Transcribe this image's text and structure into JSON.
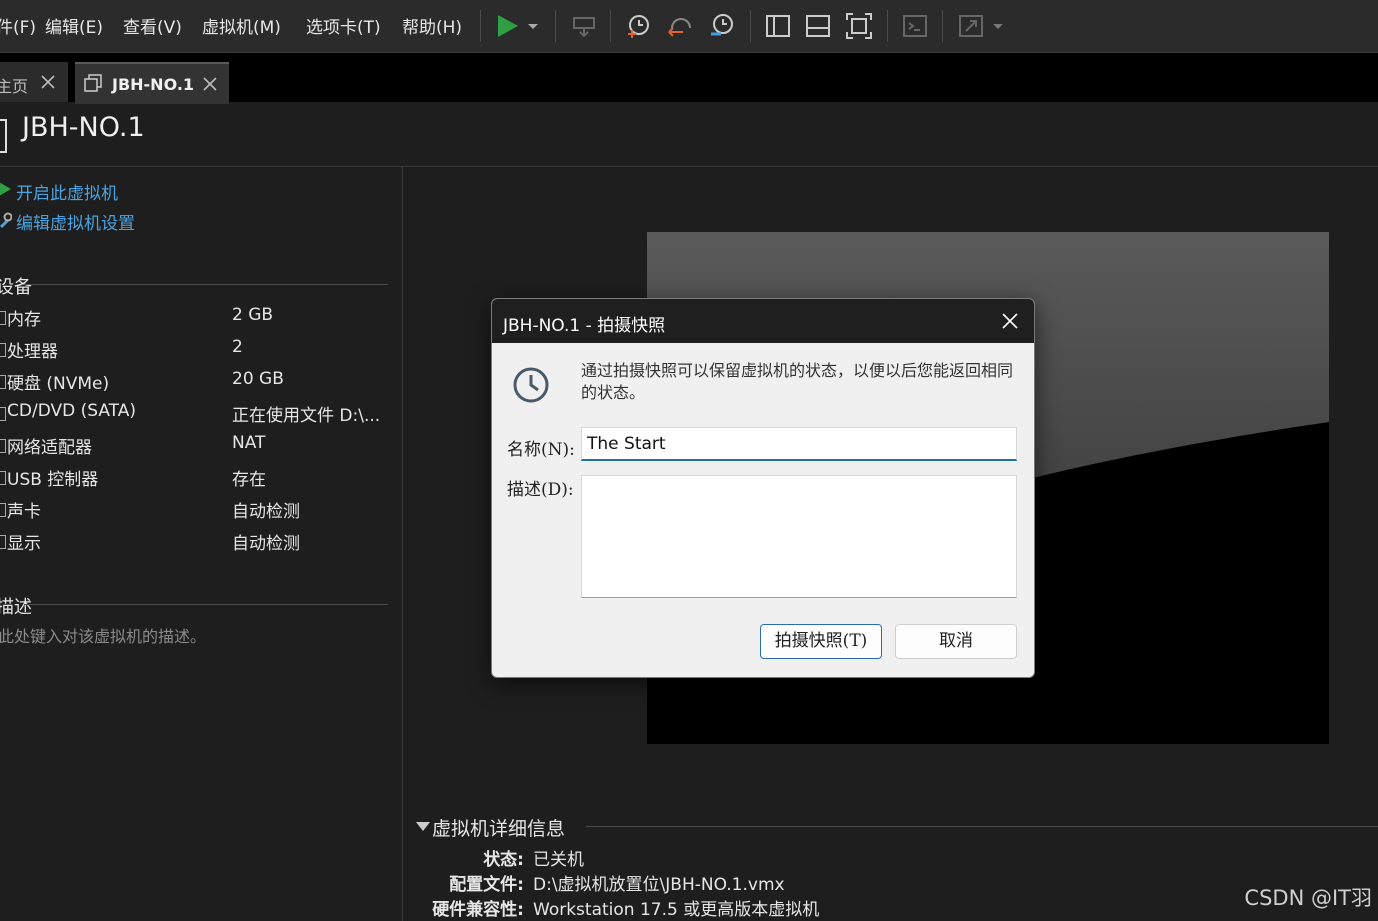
{
  "menubar": {
    "items": [
      "件(F)",
      "编辑(E)",
      "查看(V)",
      "虚拟机(M)",
      "选项卡(T)",
      "帮助(H)"
    ]
  },
  "tabs": [
    {
      "label": "主页"
    },
    {
      "label": "JBH-NO.1"
    }
  ],
  "vm": {
    "title": "JBH-NO.1"
  },
  "actions": {
    "power_on": "开启此虚拟机",
    "edit_settings": "编辑虚拟机设置"
  },
  "devices": {
    "section": "设备",
    "rows": [
      {
        "name": "内存",
        "value": "2 GB"
      },
      {
        "name": "处理器",
        "value": "2"
      },
      {
        "name": "硬盘 (NVMe)",
        "value": "20 GB"
      },
      {
        "name": "CD/DVD (SATA)",
        "value": "正在使用文件 D:\\..."
      },
      {
        "name": "网络适配器",
        "value": "NAT"
      },
      {
        "name": "USB 控制器",
        "value": "存在"
      },
      {
        "name": "声卡",
        "value": "自动检测"
      },
      {
        "name": "显示",
        "value": "自动检测"
      }
    ]
  },
  "description": {
    "section": "描述",
    "hint": "在此处键入对该虚拟机的描述。"
  },
  "details": {
    "title": "虚拟机详细信息",
    "rows": [
      {
        "key": "状态:",
        "value": "已关机"
      },
      {
        "key": "配置文件:",
        "value": "D:\\虚拟机放置位\\JBH-NO.1.vmx"
      },
      {
        "key": "硬件兼容性:",
        "value": "Workstation 17.5 或更高版本虚拟机"
      }
    ]
  },
  "dialog": {
    "title": "JBH-NO.1 - 拍摄快照",
    "info": "通过拍摄快照可以保留虚拟机的状态，以便以后您能返回相同的状态。",
    "name_label": "名称(N):",
    "name_value": "The Start",
    "desc_label": "描述(D):",
    "desc_value": "",
    "snapshot_button": "拍摄快照(T)",
    "cancel_button": "取消"
  },
  "watermark": "CSDN @IT羽",
  "colors": {
    "link": "#4aa3df",
    "play": "#2ea043",
    "accent": "#1f6fb5"
  }
}
